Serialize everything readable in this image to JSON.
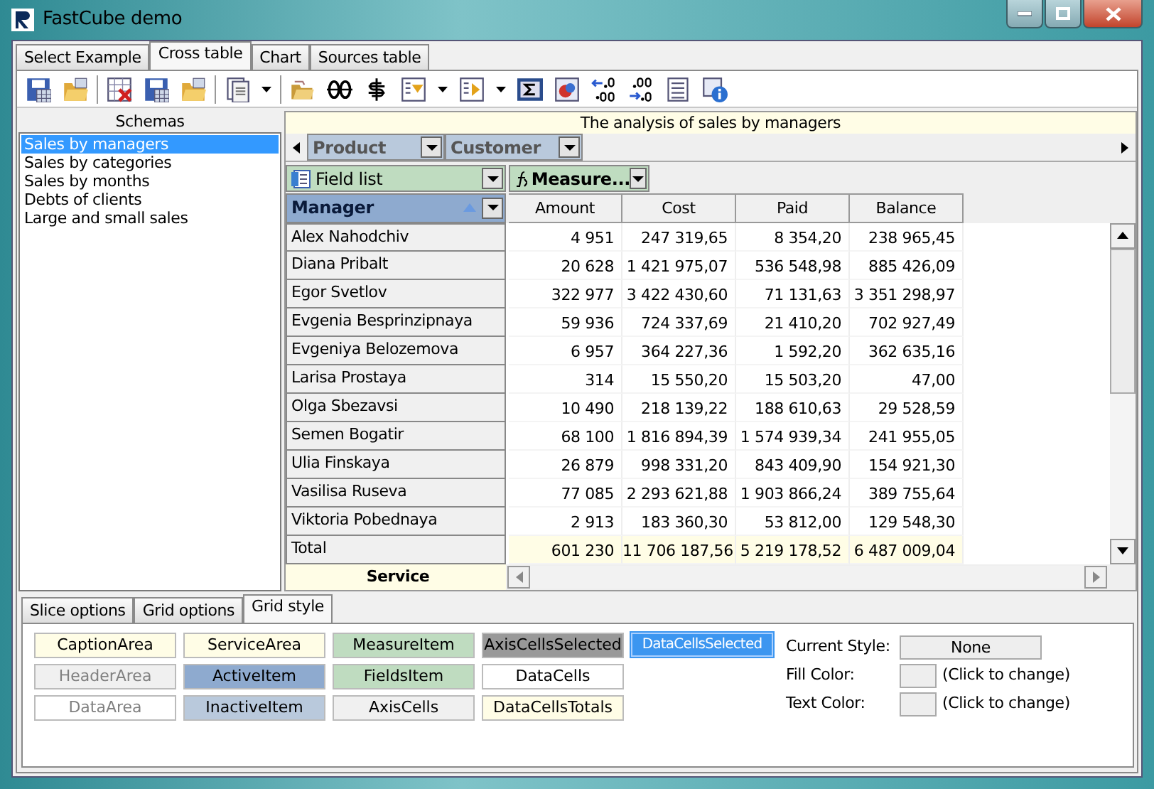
{
  "window": {
    "title": "FastCube demo"
  },
  "main_tabs": [
    {
      "label": "Select Example",
      "selected": false
    },
    {
      "label": "Cross table",
      "selected": true
    },
    {
      "label": "Chart",
      "selected": false
    },
    {
      "label": "Sources table",
      "selected": false
    }
  ],
  "schemas": {
    "title": "Schemas",
    "items": [
      {
        "label": "Sales by managers",
        "selected": true
      },
      {
        "label": "Sales by categories",
        "selected": false
      },
      {
        "label": "Sales by months",
        "selected": false
      },
      {
        "label": "Debts of clients",
        "selected": false
      },
      {
        "label": "Large and small sales",
        "selected": false
      }
    ]
  },
  "grid": {
    "caption": "The analysis of sales by managers",
    "column_fields": [
      {
        "label": "Product"
      },
      {
        "label": "Customer"
      }
    ],
    "field_list": "Field list",
    "measures": "Measure...",
    "row_field": "Manager",
    "columns": [
      "Amount",
      "Cost",
      "Paid",
      "Balance"
    ],
    "rows": [
      {
        "kind": "data",
        "label": "Alex Nahodchiv",
        "values": [
          "4 951",
          "247 319,65",
          "8 354,20",
          "238 965,45"
        ]
      },
      {
        "kind": "data",
        "label": "Diana Pribalt",
        "values": [
          "20 628",
          "1 421 975,07",
          "536 548,98",
          "885 426,09"
        ]
      },
      {
        "kind": "data",
        "label": "Egor Svetlov",
        "values": [
          "322 977",
          "3 422 430,60",
          "71 131,63",
          "3 351 298,97"
        ]
      },
      {
        "kind": "data",
        "label": "Evgenia Besprinzipnaya",
        "values": [
          "59 936",
          "724 337,69",
          "21 410,20",
          "702 927,49"
        ]
      },
      {
        "kind": "data",
        "label": "Evgeniya Belozemova",
        "values": [
          "6 957",
          "364 227,36",
          "1 592,20",
          "362 635,16"
        ]
      },
      {
        "kind": "data",
        "label": "Larisa Prostaya",
        "values": [
          "314",
          "15 550,20",
          "15 503,20",
          "47,00"
        ]
      },
      {
        "kind": "data",
        "label": "Olga Sbezavsi",
        "values": [
          "10 490",
          "218 139,22",
          "188 610,63",
          "29 528,59"
        ]
      },
      {
        "kind": "data",
        "label": "Semen Bogatir",
        "values": [
          "68 100",
          "1 816 894,39",
          "1 574 939,34",
          "241 955,05"
        ]
      },
      {
        "kind": "data",
        "label": "Ulia Finskaya",
        "values": [
          "26 879",
          "998 331,20",
          "843 409,90",
          "154 921,30"
        ]
      },
      {
        "kind": "data",
        "label": "Vasilisa Ruseva",
        "values": [
          "77 085",
          "2 293 621,88",
          "1 903 866,24",
          "389 755,64"
        ]
      },
      {
        "kind": "data",
        "label": "Viktoria Pobednaya",
        "values": [
          "2 913",
          "183 360,30",
          "53 812,00",
          "129 548,30"
        ]
      },
      {
        "kind": "total",
        "label": "Total",
        "values": [
          "601 230",
          "11 706 187,56",
          "5 219 178,52",
          "6 487 009,04"
        ]
      }
    ],
    "service": "Service"
  },
  "bottom_tabs": [
    {
      "label": "Slice options",
      "selected": false
    },
    {
      "label": "Grid options",
      "selected": false
    },
    {
      "label": "Grid style",
      "selected": true
    }
  ],
  "style_columns": [
    [
      {
        "kind": "plain",
        "label": "CaptionArea",
        "color": "#fffde6"
      },
      {
        "kind": "dim",
        "label": "HeaderArea",
        "color": "#f0f0f0"
      },
      {
        "kind": "dim",
        "label": "DataArea",
        "color": "#ffffff"
      }
    ],
    [
      {
        "kind": "plain",
        "label": "ServiceArea",
        "color": "#fffde6"
      },
      {
        "kind": "plain",
        "label": "ActiveItem",
        "color": "#8eaacf"
      },
      {
        "kind": "plain",
        "label": "InactiveItem",
        "color": "#b9c9dc"
      }
    ],
    [
      {
        "kind": "plain",
        "label": "MeasureItem",
        "color": "#bfdcc0"
      },
      {
        "kind": "plain",
        "label": "FieldsItem",
        "color": "#bfdcc0"
      },
      {
        "kind": "plain",
        "label": "AxisCells",
        "color": "#f0f0f0"
      }
    ],
    [
      {
        "kind": "plain",
        "label": "AxisCellsSelected",
        "color": "#999999"
      },
      {
        "kind": "plain",
        "label": "DataCells",
        "color": "#ffffff"
      },
      {
        "kind": "plain",
        "label": "DataCellsTotals",
        "color": "#fffde6"
      }
    ],
    [
      {
        "kind": "inverse",
        "label": "DataCellsSelected",
        "color": "#3c96f0"
      }
    ]
  ],
  "current_style": {
    "label": "Current Style:",
    "value": "None"
  },
  "fill_color": {
    "label": "Fill Color:",
    "hint": "(Click to change)"
  },
  "text_color": {
    "label": "Text Color:",
    "hint": "(Click to change)"
  }
}
